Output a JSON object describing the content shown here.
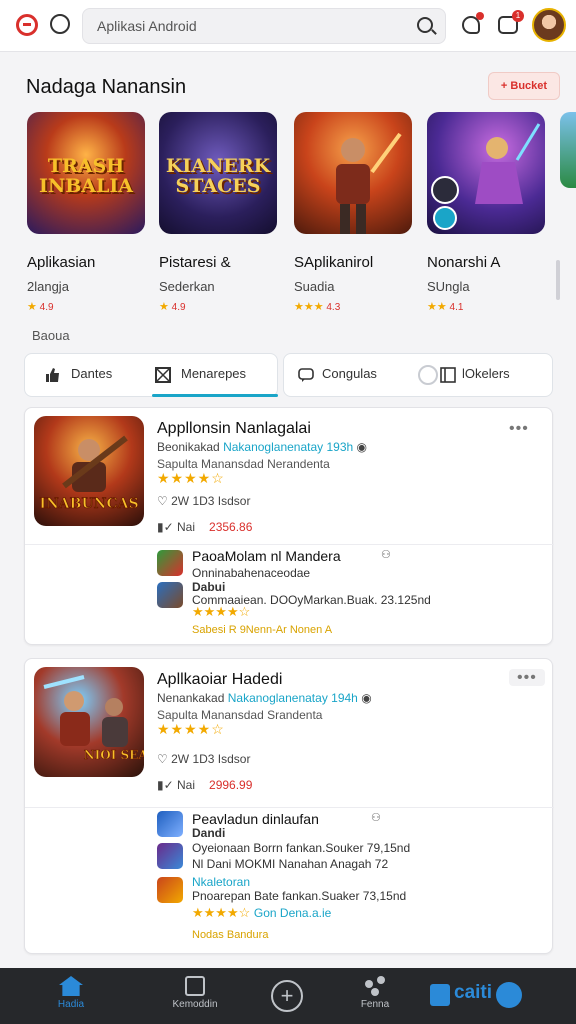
{
  "header": {
    "search_placeholder": "Aplikasi Android",
    "notification_count": "1"
  },
  "featured": {
    "title": "Nadaga Nanansin",
    "action_label": "+ Bucket",
    "footer_label": "Baoua",
    "items": [
      {
        "art": "TRASH INBALIA",
        "name": "Aplikasian",
        "sub": "2langja",
        "rating": "4.9"
      },
      {
        "art": "KIANERK STACES",
        "name": "Pistaresi &",
        "sub": "Sederkan",
        "rating": "4.9"
      },
      {
        "art": "",
        "name": "SAplikanirol",
        "sub": "Suadia",
        "rating": "4.3"
      },
      {
        "art": "",
        "name": "Nonarshi A",
        "sub": "SUngla",
        "rating": "4.1"
      }
    ]
  },
  "tabs": {
    "tab1": "Dantes",
    "tab2": "Menarepes",
    "tab3": "Congulas",
    "tab4": "lOkelers"
  },
  "cards": [
    {
      "title": "Appllonsin Nanlagalai",
      "dev": "Beonikakad",
      "dev_teal": "Nakanoglanenatay 193h",
      "desc": "Sapulta Manansdad Nerandenta",
      "stars": "★★★★☆",
      "likes": "2W  1D3  Isdsor",
      "price_label": "Nai",
      "price": "2356.86",
      "art": "INABUNCAS",
      "subs": [
        {
          "title": "PaoaMolam nl Mandera",
          "line": "Onninabahenaceodae",
          "extra": "Dabui"
        },
        {
          "title": "",
          "line": "Commaaiean. DOOyMarkan.Buak. 23.125nd",
          "extra": ""
        }
      ],
      "sub_stars": "★★★★☆",
      "sub_yellow": "Sabesi R  9Nenn-Ar  Nonen A"
    },
    {
      "title": "Apllkaoiar Hadedi",
      "dev": "Nenankakad",
      "dev_teal": "Nakanoglanenatay 194h",
      "desc": "Sapulta Manansdad Srandenta",
      "stars": "★★★★☆",
      "likes": "2W  1D3  Isdsor",
      "price_label": "Nai",
      "price": "2996.99",
      "art": "NIOI SEAS",
      "subs": [
        {
          "title": "Peavladun dinlaufan",
          "line": "Oyeionaan Borrn fankan.Souker 79,15nd",
          "extra": "Dandi"
        },
        {
          "title": "",
          "line": "Nl Dani MOKMI Nanahan Anagah 72",
          "extra": ""
        },
        {
          "title": "Nkaletoran",
          "line": "Pnoarepan Bate fankan.Suaker 73,15nd",
          "extra": ""
        }
      ],
      "sub_stars": "★★★★☆",
      "sub_stars_label": "Gon Dena.a.ie",
      "sub_yellow": "Nodas Bandura"
    }
  ],
  "nav": {
    "home": "Hadia",
    "library": "Kemoddin",
    "people": "Fenna",
    "brand": "caiti"
  }
}
